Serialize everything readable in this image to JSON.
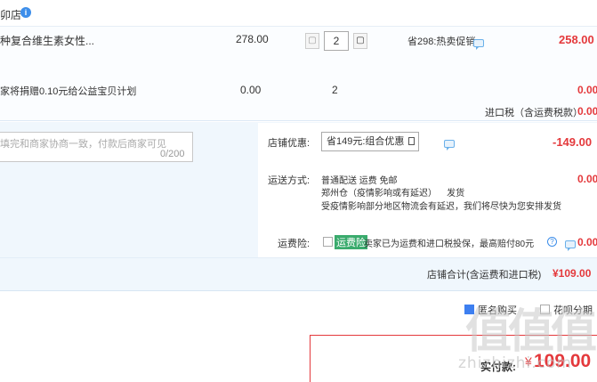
{
  "store": {
    "name_fragment": "卯店",
    "badge": "i"
  },
  "items": [
    {
      "name": "种复合维生素女性...",
      "unit_price": "278.00",
      "quantity": "2",
      "promo": "省298:热卖促销",
      "subtotal": "258.00"
    },
    {
      "name": "家将捐赠0.10元给公益宝贝计划",
      "unit_price": "0.00",
      "quantity": "2",
      "subtotal": "0.00"
    }
  ],
  "import_tax": {
    "label": "进口税（含运费税款）",
    "value": "0.00"
  },
  "message": {
    "placeholder": "填完和商家协商一致，付款后商家可见",
    "counter": "0/200"
  },
  "shop_discount": {
    "label": "店铺优惠:",
    "selected": "省149元:组合优惠",
    "value": "-149.00"
  },
  "shipping": {
    "label": "运送方式:",
    "line1": "普通配送 运费 免邮",
    "line2a": "郑州仓",
    "line2b": "（疫情影响或有延迟）",
    "line2c": "发货",
    "line3": "受疫情影响部分地区物流会有延迟，我们将尽快为您安排发货",
    "value": "0.00"
  },
  "insurance": {
    "label": "运费险:",
    "tag": "运费险",
    "desc": "卖家已为运费和进口税投保，最高赔付80元",
    "value": "0.00"
  },
  "shop_total": {
    "label": "店铺合计(含运费和进口税)",
    "value": "¥109.00"
  },
  "options": {
    "anonymous": "匿名购买",
    "huabei": "花呗分期"
  },
  "payment": {
    "label": "实付款:",
    "symbol": "¥",
    "value": "109.00"
  },
  "watermark": {
    "main": "值值值",
    "sub": "zhizhizhi.com"
  },
  "colors": {
    "accent_red": "#e4393c",
    "link_blue": "#3d8eea",
    "panel_bg": "#f0f7fd",
    "green_tag": "#3aab6d"
  }
}
